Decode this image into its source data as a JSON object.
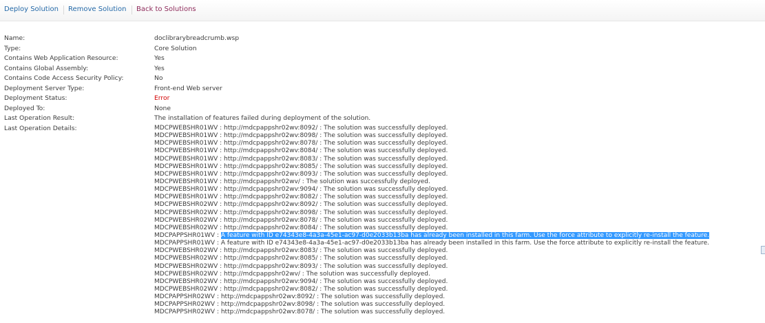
{
  "toolbar": {
    "deploy": "Deploy Solution",
    "remove": "Remove Solution",
    "back": "Back to Solutions"
  },
  "properties": [
    {
      "label": "Name:",
      "value": "doclibrarybreadcrumb.wsp"
    },
    {
      "label": "Type:",
      "value": "Core Solution"
    },
    {
      "label": "Contains Web Application Resource:",
      "value": "Yes"
    },
    {
      "label": "Contains Global Assembly:",
      "value": "Yes"
    },
    {
      "label": "Contains Code Access Security Policy:",
      "value": "No"
    },
    {
      "label": "Deployment Server Type:",
      "value": "Front-end Web server"
    },
    {
      "label": "Deployment Status:",
      "value": "Error",
      "status": "error"
    },
    {
      "label": "Deployed To:",
      "value": "None"
    },
    {
      "label": "Last Operation Result:",
      "value": "The installation of features failed during deployment of the solution."
    },
    {
      "label": "Last Operation Details:",
      "value": ""
    }
  ],
  "colors": {
    "link": "#2469a8",
    "error": "#d20000",
    "selection": "#3399ff"
  },
  "details": [
    {
      "prefix": "MDCPWEBSHR01WV : ",
      "text": "http://mdcpappshr02wv:8092/ : The solution was successfully deployed."
    },
    {
      "prefix": "MDCPWEBSHR01WV : ",
      "text": "http://mdcpappshr02wv:8098/ : The solution was successfully deployed."
    },
    {
      "prefix": "MDCPWEBSHR01WV : ",
      "text": "http://mdcpappshr02wv:8078/ : The solution was successfully deployed."
    },
    {
      "prefix": "MDCPWEBSHR01WV : ",
      "text": "http://mdcpappshr02wv:8084/ : The solution was successfully deployed."
    },
    {
      "prefix": "MDCPWEBSHR01WV : ",
      "text": "http://mdcpappshr02wv:8083/ : The solution was successfully deployed."
    },
    {
      "prefix": "MDCPWEBSHR01WV : ",
      "text": "http://mdcpappshr02wv:8085/ : The solution was successfully deployed."
    },
    {
      "prefix": "MDCPWEBSHR01WV : ",
      "text": "http://mdcpappshr02wv:8093/ : The solution was successfully deployed."
    },
    {
      "prefix": "MDCPWEBSHR01WV : ",
      "text": "http://mdcpappshr02wv/ : The solution was successfully deployed."
    },
    {
      "prefix": "MDCPWEBSHR01WV : ",
      "text": "http://mdcpappshr02wv:9094/ : The solution was successfully deployed."
    },
    {
      "prefix": "MDCPWEBSHR01WV : ",
      "text": "http://mdcpappshr02wv:8082/ : The solution was successfully deployed."
    },
    {
      "prefix": "MDCPWEBSHR02WV : ",
      "text": "http://mdcpappshr02wv:8092/ : The solution was successfully deployed."
    },
    {
      "prefix": "MDCPWEBSHR02WV : ",
      "text": "http://mdcpappshr02wv:8098/ : The solution was successfully deployed."
    },
    {
      "prefix": "MDCPWEBSHR02WV : ",
      "text": "http://mdcpappshr02wv:8078/ : The solution was successfully deployed."
    },
    {
      "prefix": "MDCPWEBSHR02WV : ",
      "text": "http://mdcpappshr02wv:8084/ : The solution was successfully deployed."
    },
    {
      "prefix": "MDCPAPPSHR01WV : ",
      "text": "A feature with ID e74343e8-4a3a-45e1-ac97-d0e2033b13ba has already been installed in this farm.  Use the force attribute to explicitly re-install the feature.",
      "selected": true
    },
    {
      "prefix": "MDCPAPPSHR01WV : ",
      "text": "A feature with ID e74343e8-4a3a-45e1-ac97-d0e2033b13ba has already been installed in this farm.  Use the force attribute to explicitly re-install the feature."
    },
    {
      "prefix": "MDCPWEBSHR02WV : ",
      "text": "http://mdcpappshr02wv:8083/ : The solution was successfully deployed."
    },
    {
      "prefix": "MDCPWEBSHR02WV : ",
      "text": "http://mdcpappshr02wv:8085/ : The solution was successfully deployed."
    },
    {
      "prefix": "MDCPWEBSHR02WV : ",
      "text": "http://mdcpappshr02wv:8093/ : The solution was successfully deployed."
    },
    {
      "prefix": "MDCPWEBSHR02WV : ",
      "text": "http://mdcpappshr02wv/ : The solution was successfully deployed."
    },
    {
      "prefix": "MDCPWEBSHR02WV : ",
      "text": "http://mdcpappshr02wv:9094/ : The solution was successfully deployed."
    },
    {
      "prefix": "MDCPWEBSHR02WV : ",
      "text": "http://mdcpappshr02wv:8082/ : The solution was successfully deployed."
    },
    {
      "prefix": "MDCPAPPSHR02WV : ",
      "text": "http://mdcpappshr02wv:8092/ : The solution was successfully deployed."
    },
    {
      "prefix": "MDCPAPPSHR02WV : ",
      "text": "http://mdcpappshr02wv:8098/ : The solution was successfully deployed."
    },
    {
      "prefix": "MDCPAPPSHR02WV : ",
      "text": "http://mdcpappshr02wv:8078/ : The solution was successfully deployed."
    }
  ]
}
